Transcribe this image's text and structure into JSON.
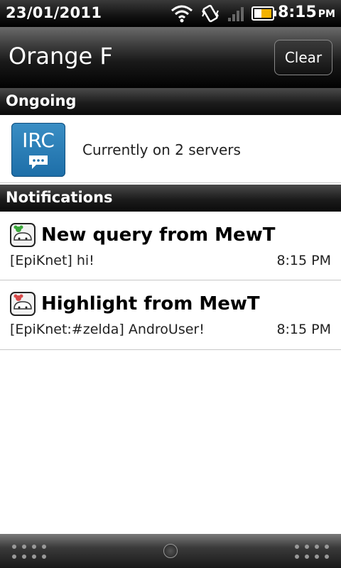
{
  "status_bar": {
    "date": "23/01/2011",
    "time": "8:15",
    "ampm": "PM",
    "icons": [
      "wifi-icon",
      "vibrate-icon",
      "signal-icon",
      "battery-icon"
    ]
  },
  "header": {
    "title": "Orange F",
    "clear_label": "Clear"
  },
  "ongoing": {
    "section_title": "Ongoing",
    "app_icon_label": "IRC",
    "text": "Currently on 2 servers"
  },
  "notifications": {
    "section_title": "Notifications",
    "items": [
      {
        "title": "New query from MewT",
        "body": "[EpiKnet] hi!",
        "time": "8:15 PM",
        "accent": "#3aa83a"
      },
      {
        "title": "Highlight from MewT",
        "body": "[EpiKnet:#zelda] AndroUser!",
        "time": "8:15 PM",
        "accent": "#d84a4a"
      }
    ]
  }
}
